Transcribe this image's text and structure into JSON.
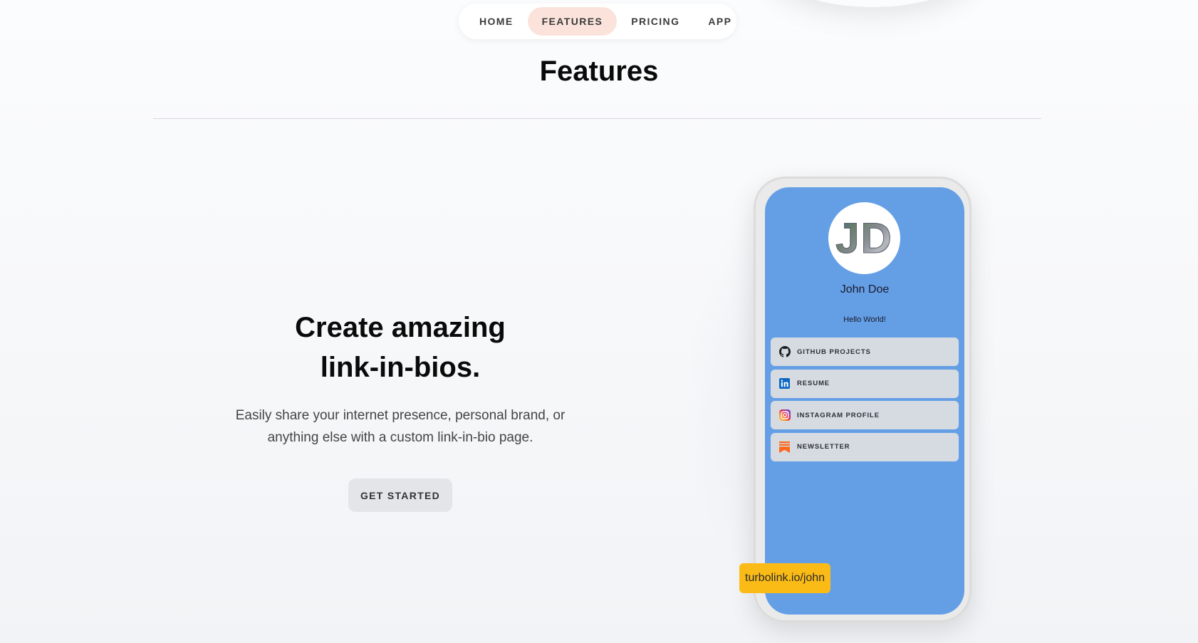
{
  "nav": {
    "items": [
      {
        "label": "HOME"
      },
      {
        "label": "FEATURES"
      },
      {
        "label": "PRICING"
      },
      {
        "label": "APP"
      }
    ]
  },
  "section": {
    "title": "Features"
  },
  "hero": {
    "title": "Create amazing link-in-bios.",
    "subtitle": "Easily share your internet presence, personal brand, or anything else with a custom link-in-bio page.",
    "cta_label": "GET STARTED"
  },
  "phone": {
    "avatar_initials": "JD",
    "name": "John Doe",
    "bio": "Hello World!",
    "links": [
      {
        "label": "GITHUB PROJECTS",
        "icon": "github-icon"
      },
      {
        "label": "RESUME",
        "icon": "linkedin-icon"
      },
      {
        "label": "INSTAGRAM PROFILE",
        "icon": "instagram-icon"
      },
      {
        "label": "NEWSLETTER",
        "icon": "substack-icon"
      }
    ],
    "url": "turbolink.io/john"
  },
  "colors": {
    "nav_active_bg": "#fbe3dc",
    "phone_screen": "#649fe6",
    "link_bg": "#d6dbe2",
    "url_badge": "#fbbb16",
    "cta_bg": "#e3e5e8"
  }
}
